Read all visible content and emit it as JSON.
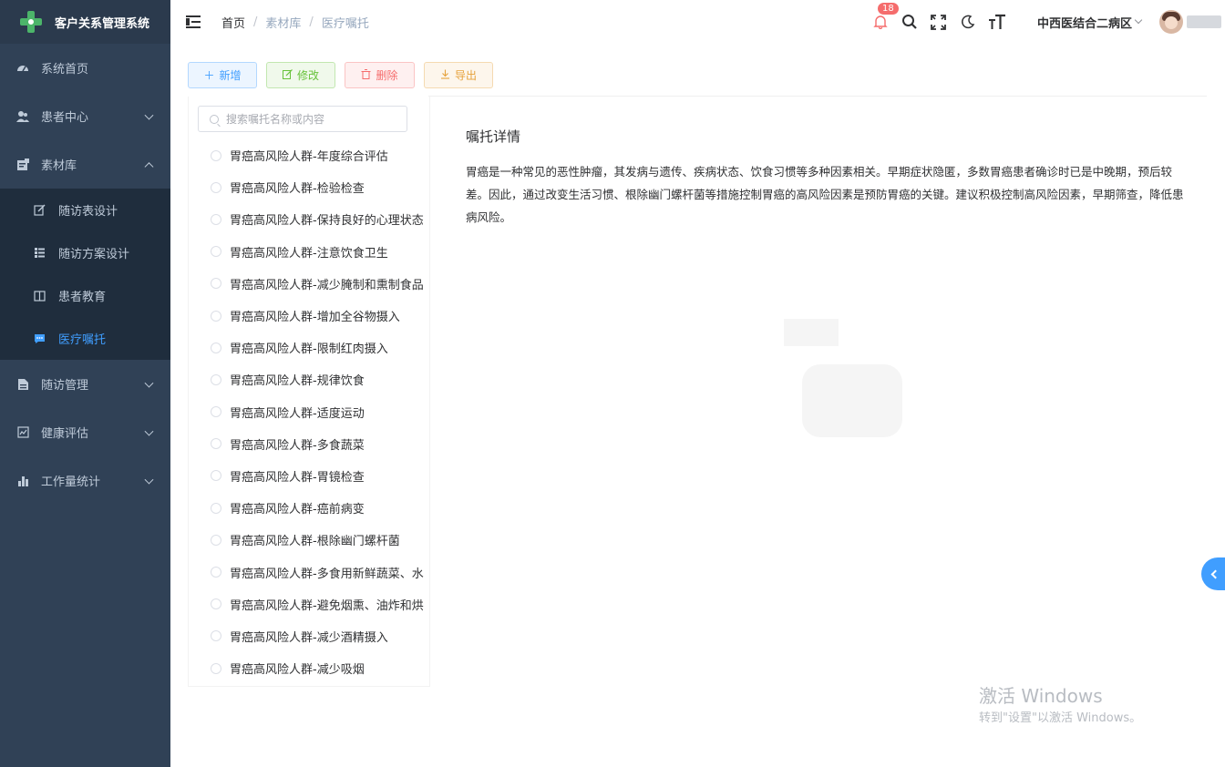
{
  "app": {
    "title": "客户关系管理系统"
  },
  "sidebar": {
    "items": [
      {
        "label": "系统首页",
        "icon": "dashboard-icon"
      },
      {
        "label": "患者中心",
        "icon": "users-icon"
      },
      {
        "label": "素材库",
        "icon": "library-icon",
        "expanded": true,
        "children": [
          {
            "label": "随访表设计",
            "icon": "edit-icon"
          },
          {
            "label": "随访方案设计",
            "icon": "list-icon"
          },
          {
            "label": "患者教育",
            "icon": "book-icon"
          },
          {
            "label": "医疗嘱托",
            "icon": "message-icon",
            "active": true
          }
        ]
      },
      {
        "label": "随访管理",
        "icon": "document-icon"
      },
      {
        "label": "健康评估",
        "icon": "chart-box-icon"
      },
      {
        "label": "工作量统计",
        "icon": "bar-chart-icon"
      }
    ]
  },
  "header": {
    "breadcrumb": [
      "首页",
      "素材库",
      "医疗嘱托"
    ],
    "notification_count": "18",
    "ward": "中西医结合二病区"
  },
  "toolbar": {
    "add_label": "新增",
    "edit_label": "修改",
    "delete_label": "删除",
    "export_label": "导出"
  },
  "search": {
    "placeholder": "搜索嘱托名称或内容"
  },
  "list": {
    "items": [
      "胃癌高风险人群-年度综合评估",
      "胃癌高风险人群-检验检查",
      "胃癌高风险人群-保持良好的心理状态",
      "胃癌高风险人群-注意饮食卫生",
      "胃癌高风险人群-减少腌制和熏制食品",
      "胃癌高风险人群-增加全谷物摄入",
      "胃癌高风险人群-限制红肉摄入",
      "胃癌高风险人群-规律饮食",
      "胃癌高风险人群-适度运动",
      "胃癌高风险人群-多食蔬菜",
      "胃癌高风险人群-胃镜检查",
      "胃癌高风险人群-癌前病变",
      "胃癌高风险人群-根除幽门螺杆菌",
      "胃癌高风险人群-多食用新鲜蔬菜、水果",
      "胃癌高风险人群-避免烟熏、油炸和烘烤食物",
      "胃癌高风险人群-减少酒精摄入",
      "胃癌高风险人群-减少吸烟"
    ]
  },
  "detail": {
    "title": "嘱托详情",
    "content": "胃癌是一种常见的恶性肿瘤，其发病与遗传、疾病状态、饮食习惯等多种因素相关。早期症状隐匿，多数胃癌患者确诊时已是中晚期，预后较差。因此，通过改变生活习惯、根除幽门螺杆菌等措施控制胃癌的高风险因素是预防胃癌的关键。建议积极控制高风险因素，早期筛查，降低患病风险。"
  },
  "watermark": {
    "line1": "激活 Windows",
    "line2": "转到\"设置\"以激活 Windows。"
  },
  "colors": {
    "sidebar_bg": "#304156",
    "accent": "#409eff",
    "success": "#67c23a",
    "danger": "#f56c6c",
    "warning": "#e6a23c"
  }
}
